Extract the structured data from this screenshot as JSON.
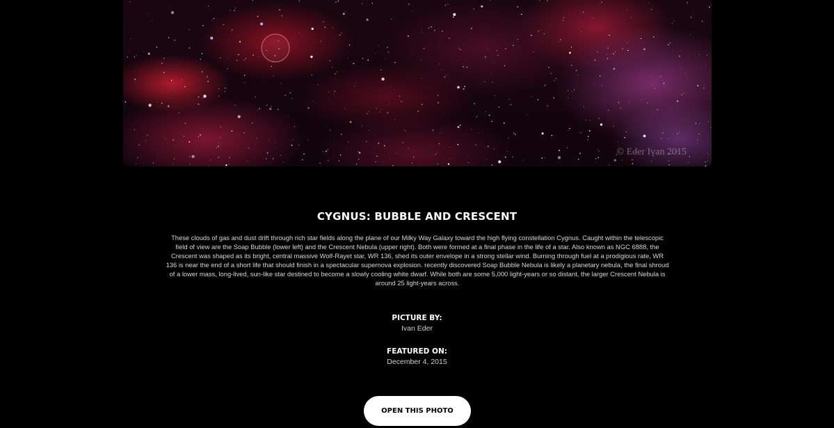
{
  "photo": {
    "alt": "Cygnus: Bubble and Crescent",
    "watermark": "© Eder Ivan 2015"
  },
  "article": {
    "title": "CYGNUS: BUBBLE AND CRESCENT",
    "description": "These clouds of gas and dust drift through rich star fields along the plane of our Milky Way Galaxy toward the high flying constellation Cygnus. Caught within the telescopic field of view are the Soap Bubble (lower left) and the Crescent Nebula (upper right). Both were formed at a final phase in the life of a star. Also known as NGC 6888, the Crescent was shaped as its bright, central massive Wolf-Rayet star, WR 136, shed its outer envelope in a strong stellar wind. Burning through fuel at a prodigious rate, WR 136 is near the end of a short life that should finish in a spectacular supernova explosion. recently discovered Soap Bubble Nebula is likely a planetary nebula, the final shroud of a lower mass, long-lived, sun-like star destined to become a slowly cooling white dwarf. While both are some 5,000 light-years or so distant, the larger Crescent Nebula is around 25 light-years across."
  },
  "meta": {
    "picture_by_label": "PICTURE BY:",
    "picture_by_value": "Ivan Eder",
    "featured_on_label": "FEATURED ON:",
    "featured_on_value": "December 4, 2015"
  },
  "actions": {
    "open_photo_label": "OPEN THIS PHOTO"
  },
  "colors": {
    "background": "#000000",
    "button_bg": "#ffffff",
    "button_text": "#000000",
    "nebula_red": "#c81e32",
    "nebula_purple": "#a046a0"
  }
}
